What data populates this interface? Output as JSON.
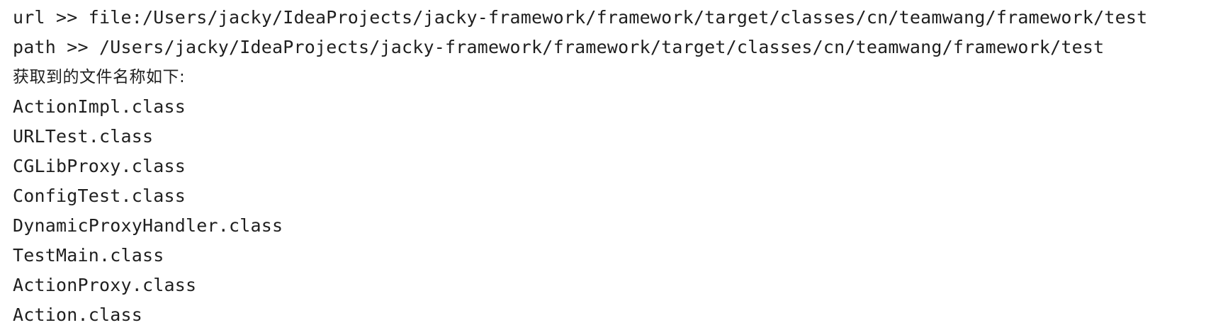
{
  "console": {
    "url_line": "url >> file:/Users/jacky/IdeaProjects/jacky-framework/framework/target/classes/cn/teamwang/framework/test",
    "path_line": "path >> /Users/jacky/IdeaProjects/jacky-framework/framework/target/classes/cn/teamwang/framework/test",
    "header_line": "获取到的文件名称如下:",
    "files": [
      "ActionImpl.class",
      "URLTest.class",
      "CGLibProxy.class",
      "ConfigTest.class",
      "DynamicProxyHandler.class",
      "TestMain.class",
      "ActionProxy.class",
      "Action.class"
    ]
  }
}
